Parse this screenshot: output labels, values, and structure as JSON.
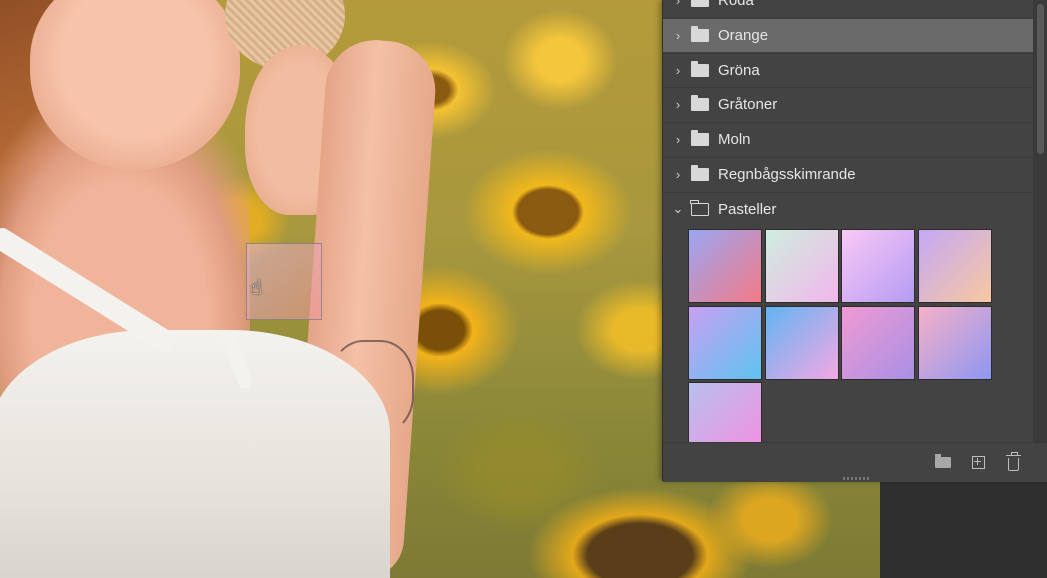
{
  "gradients_panel": {
    "groups": [
      {
        "name": "Röda",
        "state": "collapsed",
        "selected": false
      },
      {
        "name": "Orange",
        "state": "collapsed",
        "selected": true
      },
      {
        "name": "Gröna",
        "state": "collapsed",
        "selected": false
      },
      {
        "name": "Gråtoner",
        "state": "collapsed",
        "selected": false
      },
      {
        "name": "Moln",
        "state": "collapsed",
        "selected": false
      },
      {
        "name": "Regnbågsskimrande",
        "state": "collapsed",
        "selected": false
      },
      {
        "name": "Pasteller",
        "state": "expanded",
        "selected": false
      }
    ],
    "pastel_swatches": [
      {
        "from": "#9aa6f4",
        "to": "#f47a86"
      },
      {
        "from": "#cfeede",
        "to": "#f2b6ec"
      },
      {
        "from": "#fac8f6",
        "to": "#b49cf2"
      },
      {
        "from": "#c4a8f6",
        "to": "#f8c8a0"
      },
      {
        "from": "#c8a0f2",
        "to": "#5ec4f0"
      },
      {
        "from": "#62b4f2",
        "to": "#f4a8e4"
      },
      {
        "from": "#f09ad4",
        "to": "#a890e4"
      },
      {
        "from": "#f6b0c8",
        "to": "#8e96f2"
      },
      {
        "from": "#b8c0ec",
        "to": "#f48ee2"
      }
    ],
    "footer": {
      "new_group_icon": "folder-icon",
      "new_gradient_icon": "plus-square-icon",
      "delete_icon": "trash-icon"
    },
    "accent": {
      "panel_bg": "#434343",
      "selected_row": "#6a6a6a",
      "text": "#e6e6e6"
    }
  },
  "drag": {
    "cursor_icon": "grab-hand-icon",
    "cursor_glyph": "☝"
  }
}
